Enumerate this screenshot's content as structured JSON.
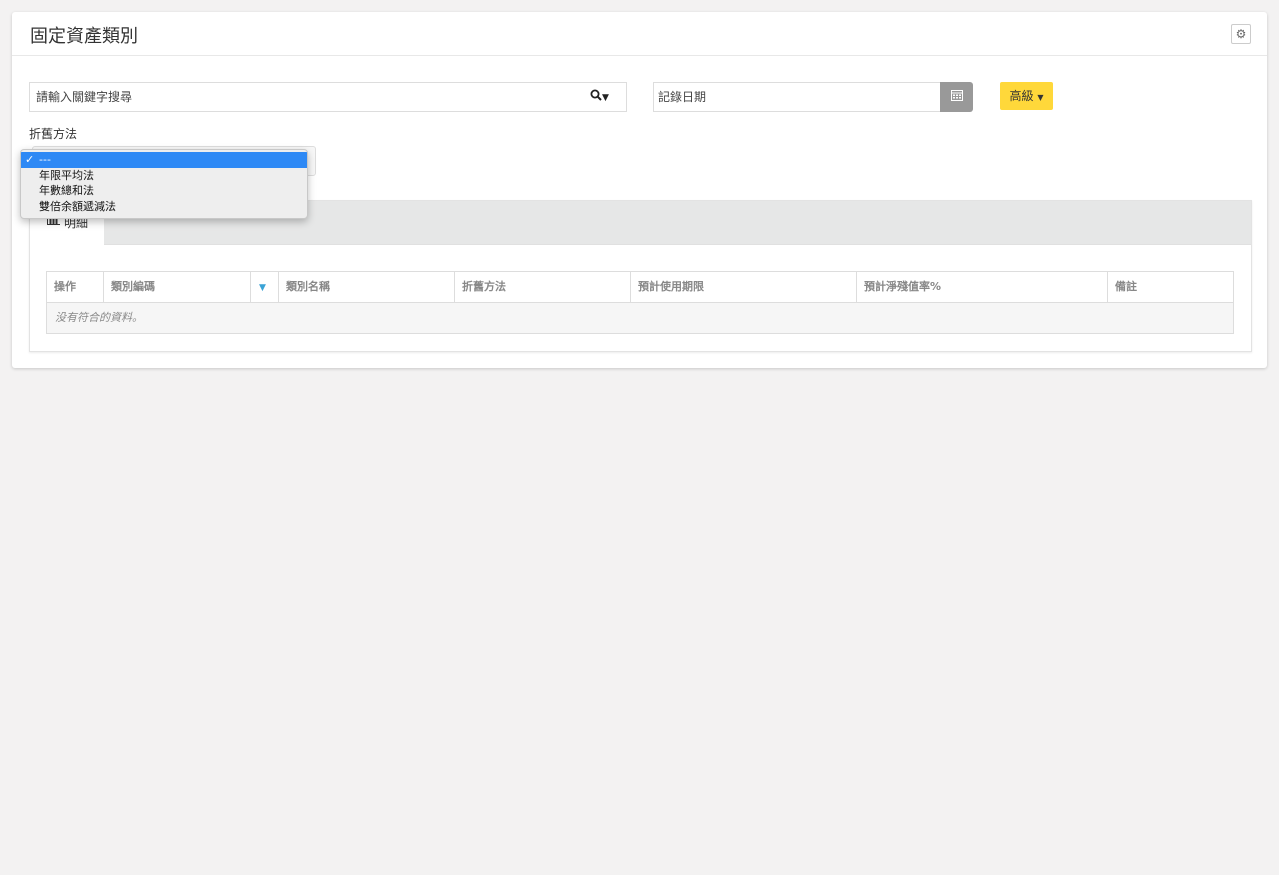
{
  "page": {
    "title": "固定資產類別"
  },
  "search": {
    "placeholder": "請輸入關鍵字搜尋"
  },
  "date_filter": {
    "placeholder": "記錄日期"
  },
  "advanced_button": {
    "label": "高級"
  },
  "depreciation_filter": {
    "label": "折舊方法",
    "selected": "---",
    "options": [
      "---",
      "年限平均法",
      "年數總和法",
      "雙倍余額遞減法"
    ]
  },
  "tabs": [
    {
      "label": "明細",
      "icon": "bar-chart-icon"
    }
  ],
  "table": {
    "columns": [
      "操作",
      "類別編碼",
      "",
      "類別名稱",
      "折舊方法",
      "預計使用期限",
      "預計淨殘值率%",
      "備註"
    ],
    "empty_text": "没有符合的資料。"
  },
  "colors": {
    "accent_yellow": "#ffd83a",
    "selected_blue": "#2e89f5",
    "calendar_grey": "#999999"
  }
}
